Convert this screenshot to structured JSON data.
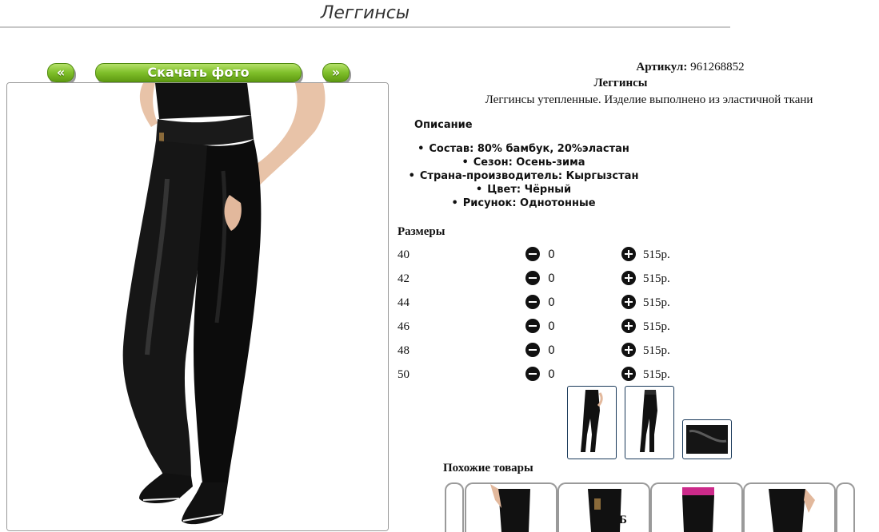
{
  "page": {
    "title": "Леггинсы"
  },
  "nav": {
    "prev_label": "«",
    "download_label": "Скачать фото",
    "next_label": "»"
  },
  "product": {
    "article_label": "Артикул:",
    "article_value": "961268852",
    "name": "Леггинсы",
    "description": "Леггинсы утепленные. Изделие выполнено из эластичной ткани",
    "description_heading": "Описание",
    "specs": [
      "Состав: 80% бамбук, 20%эластан",
      "Сезон: Осень-зима",
      "Страна-производитель: Кыргызстан",
      "Цвет: Чёрный",
      "Рисунок: Однотонные"
    ]
  },
  "sizes": {
    "heading": "Размеры",
    "rows": [
      {
        "size": "40",
        "qty": "0",
        "price": "515р."
      },
      {
        "size": "42",
        "qty": "0",
        "price": "515р."
      },
      {
        "size": "44",
        "qty": "0",
        "price": "515р."
      },
      {
        "size": "46",
        "qty": "0",
        "price": "515р."
      },
      {
        "size": "48",
        "qty": "0",
        "price": "515р."
      },
      {
        "size": "50",
        "qty": "0",
        "price": "515р."
      }
    ]
  },
  "similar": {
    "heading": "Похожие товары",
    "bottom_fragment": "Б"
  },
  "icons": {
    "minus": "minus-circle-icon",
    "plus": "plus-circle-icon"
  },
  "colors": {
    "accent_green": "#7fbf2a",
    "thumb_border": "#1a3a5a",
    "product_black": "#111111"
  }
}
